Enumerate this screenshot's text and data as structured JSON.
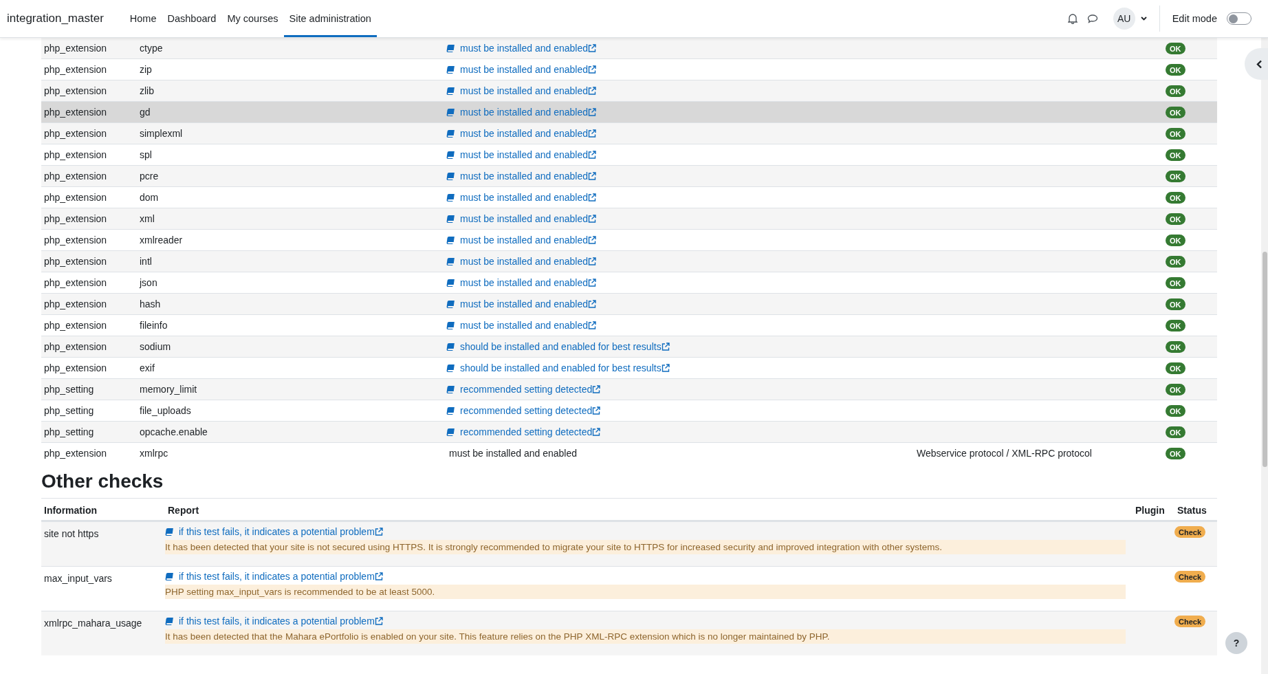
{
  "header": {
    "site_name": "integration_master",
    "nav": [
      {
        "label": "Home",
        "selected": false
      },
      {
        "label": "Dashboard",
        "selected": false
      },
      {
        "label": "My courses",
        "selected": false
      },
      {
        "label": "Site administration",
        "selected": true
      }
    ],
    "avatar": "AU",
    "edit_mode": {
      "label": "Edit mode",
      "on": false
    }
  },
  "environment_table": {
    "rows": [
      {
        "column_1": "php_extension",
        "column_2": "ctype",
        "column_3": {
          "kind": "link",
          "text": "must be installed and enabled"
        },
        "status": {
          "kind": "ok",
          "label": "OK"
        },
        "highlighted": false
      },
      {
        "column_1": "php_extension",
        "column_2": "zip",
        "column_3": {
          "kind": "link",
          "text": "must be installed and enabled"
        },
        "status": {
          "kind": "ok",
          "label": "OK"
        },
        "highlighted": false
      },
      {
        "column_1": "php_extension",
        "column_2": "zlib",
        "column_3": {
          "kind": "link",
          "text": "must be installed and enabled"
        },
        "status": {
          "kind": "ok",
          "label": "OK"
        },
        "highlighted": false
      },
      {
        "column_1": "php_extension",
        "column_2": "gd",
        "column_3": {
          "kind": "link",
          "text": "must be installed and enabled"
        },
        "status": {
          "kind": "ok",
          "label": "OK"
        },
        "highlighted": true
      },
      {
        "column_1": "php_extension",
        "column_2": "simplexml",
        "column_3": {
          "kind": "link",
          "text": "must be installed and enabled"
        },
        "status": {
          "kind": "ok",
          "label": "OK"
        },
        "highlighted": false
      },
      {
        "column_1": "php_extension",
        "column_2": "spl",
        "column_3": {
          "kind": "link",
          "text": "must be installed and enabled"
        },
        "status": {
          "kind": "ok",
          "label": "OK"
        },
        "highlighted": false
      },
      {
        "column_1": "php_extension",
        "column_2": "pcre",
        "column_3": {
          "kind": "link",
          "text": "must be installed and enabled"
        },
        "status": {
          "kind": "ok",
          "label": "OK"
        },
        "highlighted": false
      },
      {
        "column_1": "php_extension",
        "column_2": "dom",
        "column_3": {
          "kind": "link",
          "text": "must be installed and enabled"
        },
        "status": {
          "kind": "ok",
          "label": "OK"
        },
        "highlighted": false
      },
      {
        "column_1": "php_extension",
        "column_2": "xml",
        "column_3": {
          "kind": "link",
          "text": "must be installed and enabled"
        },
        "status": {
          "kind": "ok",
          "label": "OK"
        },
        "highlighted": false
      },
      {
        "column_1": "php_extension",
        "column_2": "xmlreader",
        "column_3": {
          "kind": "link",
          "text": "must be installed and enabled"
        },
        "status": {
          "kind": "ok",
          "label": "OK"
        },
        "highlighted": false
      },
      {
        "column_1": "php_extension",
        "column_2": "intl",
        "column_3": {
          "kind": "link",
          "text": "must be installed and enabled"
        },
        "status": {
          "kind": "ok",
          "label": "OK"
        },
        "highlighted": false
      },
      {
        "column_1": "php_extension",
        "column_2": "json",
        "column_3": {
          "kind": "link",
          "text": "must be installed and enabled"
        },
        "status": {
          "kind": "ok",
          "label": "OK"
        },
        "highlighted": false
      },
      {
        "column_1": "php_extension",
        "column_2": "hash",
        "column_3": {
          "kind": "link",
          "text": "must be installed and enabled"
        },
        "status": {
          "kind": "ok",
          "label": "OK"
        },
        "highlighted": false
      },
      {
        "column_1": "php_extension",
        "column_2": "fileinfo",
        "column_3": {
          "kind": "link",
          "text": "must be installed and enabled"
        },
        "status": {
          "kind": "ok",
          "label": "OK"
        },
        "highlighted": false
      },
      {
        "column_1": "php_extension",
        "column_2": "sodium",
        "column_3": {
          "kind": "link",
          "text": "should be installed and enabled for best results"
        },
        "status": {
          "kind": "ok",
          "label": "OK"
        },
        "highlighted": false
      },
      {
        "column_1": "php_extension",
        "column_2": "exif",
        "column_3": {
          "kind": "link",
          "text": "should be installed and enabled for best results"
        },
        "status": {
          "kind": "ok",
          "label": "OK"
        },
        "highlighted": false
      },
      {
        "column_1": "php_setting",
        "column_2": "memory_limit",
        "column_3": {
          "kind": "link",
          "text": "recommended setting detected"
        },
        "status": {
          "kind": "ok",
          "label": "OK"
        },
        "highlighted": false
      },
      {
        "column_1": "php_setting",
        "column_2": "file_uploads",
        "column_3": {
          "kind": "link",
          "text": "recommended setting detected"
        },
        "status": {
          "kind": "ok",
          "label": "OK"
        },
        "highlighted": false
      },
      {
        "column_1": "php_setting",
        "column_2": "opcache.enable",
        "column_3": {
          "kind": "link",
          "text": "recommended setting detected"
        },
        "status": {
          "kind": "ok",
          "label": "OK"
        },
        "highlighted": false
      },
      {
        "column_1": "php_extension",
        "column_2": "xmlrpc",
        "column_3": {
          "kind": "text",
          "text": "must be installed and enabled"
        },
        "column_4": "Webservice protocol / XML-RPC protocol",
        "status": {
          "kind": "ok",
          "label": "OK"
        },
        "highlighted": false
      }
    ]
  },
  "other_checks": {
    "title": "Other checks",
    "columns": [
      "Information",
      "Report",
      "Plugin",
      "Status"
    ],
    "rows": [
      {
        "information": "site not https",
        "report": "if this test fails, it indicates a potential problem",
        "message": "It has been detected that your site is not secured using HTTPS. It is strongly recommended to migrate your site to HTTPS for increased security and improved integration with other systems.",
        "status": {
          "kind": "warning",
          "label": "Check"
        }
      },
      {
        "information": "max_input_vars",
        "report": "if this test fails, it indicates a potential problem",
        "message": "PHP setting max_input_vars is recommended to be at least 5000.",
        "status": {
          "kind": "warning",
          "label": "Check"
        }
      },
      {
        "information": "xmlrpc_mahara_usage",
        "report": "if this test fails, it indicates a potential problem",
        "message": "It has been detected that the Mahara ePortfolio is enabled on your site. This feature relies on the PHP XML-RPC extension which is no longer maintained by PHP.",
        "status": {
          "kind": "warning",
          "label": "Check"
        }
      }
    ]
  },
  "help_button": "?"
}
